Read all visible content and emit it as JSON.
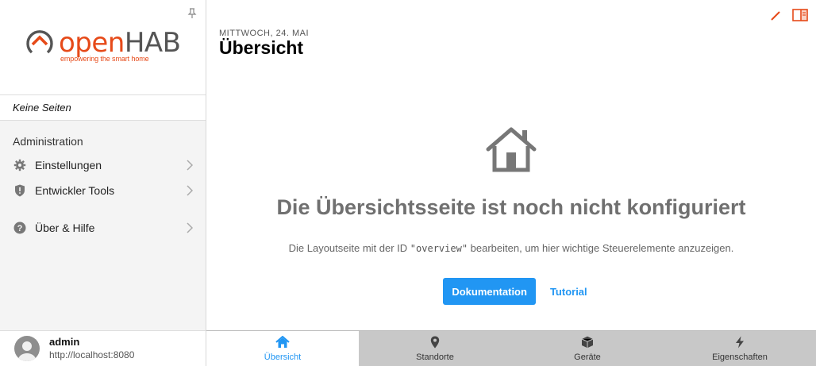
{
  "sidebar": {
    "logo": {
      "brand_open": "open",
      "brand_hab": "HAB",
      "tagline": "empowering the smart home"
    },
    "no_pages_label": "Keine Seiten",
    "section_title": "Administration",
    "items": [
      {
        "label": "Einstellungen",
        "icon": "gear-icon"
      },
      {
        "label": "Entwickler Tools",
        "icon": "shield-icon"
      },
      {
        "label": "Über & Hilfe",
        "icon": "help-icon"
      }
    ],
    "user": {
      "name": "admin",
      "url": "http://localhost:8080"
    }
  },
  "header": {
    "date": "MITTWOCH, 24. MAI",
    "title": "Übersicht"
  },
  "empty_state": {
    "title": "Die Übersichtsseite ist noch nicht konfiguriert",
    "desc_before": "Die Layoutseite mit der ID ",
    "desc_code": "\"overview\"",
    "desc_after": " bearbeiten, um hier wichtige Steuerelemente anzuzeigen.",
    "primary_button": "Dokumentation",
    "secondary_link": "Tutorial"
  },
  "tabs": [
    {
      "label": "Übersicht",
      "icon": "home-icon",
      "active": true
    },
    {
      "label": "Standorte",
      "icon": "location-pin-icon",
      "active": false
    },
    {
      "label": "Geräte",
      "icon": "cube-icon",
      "active": false
    },
    {
      "label": "Eigenschaften",
      "icon": "lightning-icon",
      "active": false
    }
  ],
  "colors": {
    "accent": "#2196f3",
    "brand": "#e64a19",
    "tabbar_bg": "#c8c8c8"
  }
}
